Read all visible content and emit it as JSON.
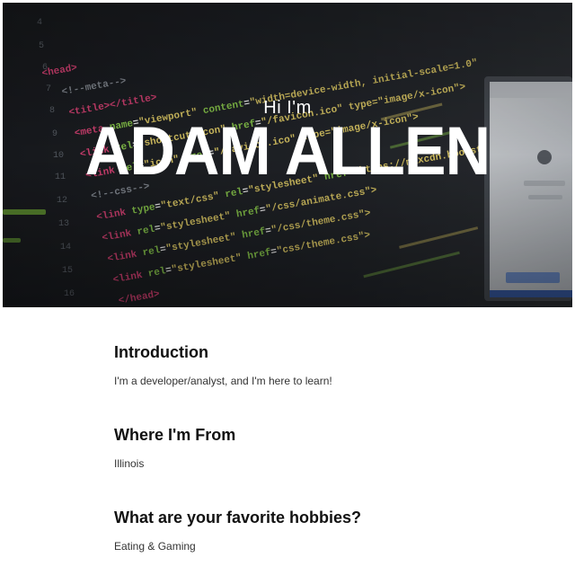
{
  "hero": {
    "kicker": "Hi I'm",
    "name": "ADAM ALLEN",
    "background": "code-editor-photo"
  },
  "sections": [
    {
      "title": "Introduction",
      "text": "I'm a developer/analyst, and I'm here to learn!"
    },
    {
      "title": "Where I'm From",
      "text": "Illinois"
    },
    {
      "title": "What are your favorite hobbies?",
      "text": "Eating & Gaming"
    }
  ],
  "colors": {
    "hero_text": "#ffffff",
    "heading": "#111111",
    "body_text": "#333333",
    "background": "#ffffff"
  }
}
